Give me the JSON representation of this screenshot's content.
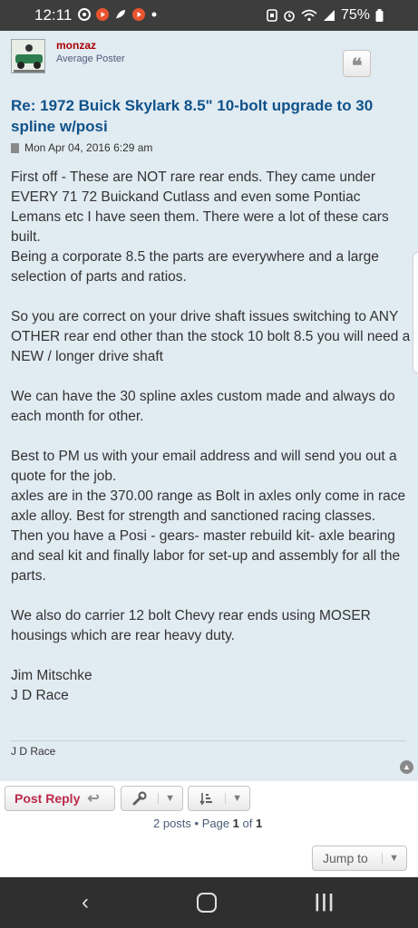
{
  "statusbar": {
    "time": "12:11",
    "battery_pct": "75%",
    "icons": [
      "settings-icon",
      "youtube-icon",
      "feather-icon",
      "youtube-icon",
      "dot-icon",
      "sim-icon",
      "alarm-icon",
      "wifi-icon",
      "signal-icon",
      "battery-icon"
    ]
  },
  "post": {
    "author": "monzaz",
    "rank": "Average Poster",
    "title": "Re: 1972 Buick Skylark 8.5\" 10-bolt upgrade to 30 spline w/posi",
    "date": "Mon Apr 04, 2016 6:29 am",
    "body": [
      "First off - These are NOT rare rear ends. They came under EVERY 71 72 Buickand Cutlass and even some Pontiac Lemans etc I have seen them. There were a lot of these cars built.\nBeing a corporate 8.5 the parts are everywhere and a large selection of parts and ratios.",
      "So you are correct on your drive shaft issues switching to ANY OTHER rear end other than the stock 10 bolt 8.5 you will need a NEW / longer drive shaft",
      "We can have the 30 spline axles custom made and always do each month for other.",
      "Best to PM us with your email address and will send you out a quote for the job.\naxles are in the 370.00 range as Bolt in axles only come in race axle alloy. Best for strength and sanctioned racing classes.\nThen you have a Posi - gears- master rebuild kit- axle bearing and seal kit and finally labor for set-up and assembly for all the parts.",
      "We also do carrier 12 bolt Chevy rear ends using MOSER housings which are rear heavy duty.",
      "Jim Mitschke\nJ D Race"
    ],
    "signature": "J D Race"
  },
  "actions": {
    "post_reply": "Post Reply",
    "pagination_prefix": "2 posts • Page ",
    "page_current": "1",
    "pagination_of": " of ",
    "page_total": "1",
    "jump_to": "Jump to"
  }
}
